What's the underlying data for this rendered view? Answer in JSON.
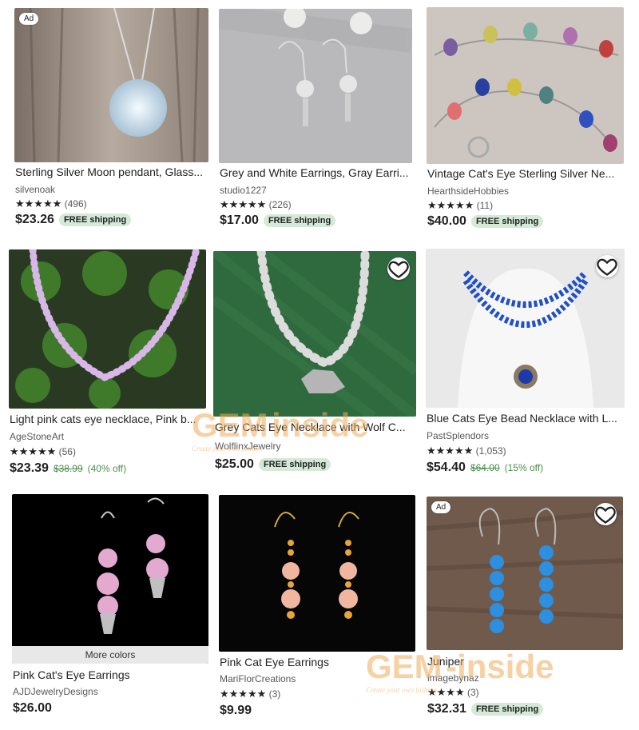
{
  "listings": [
    {
      "title": "Sterling Silver Moon pendant, Glass...",
      "shop": "silvenoak",
      "stars": "★★★★★",
      "reviews": "(496)",
      "price": "$23.26",
      "shipping": "FREE shipping",
      "badge": "Ad"
    },
    {
      "title": "Grey and White Earrings, Gray Earri...",
      "shop": "studio1227",
      "stars": "★★★★★",
      "reviews": "(226)",
      "price": "$17.00",
      "shipping": "FREE shipping"
    },
    {
      "title": "Vintage Cat's Eye Sterling Silver Ne...",
      "shop": "HearthsideHobbies",
      "stars": "★★★★★",
      "reviews": "(11)",
      "price": "$40.00",
      "shipping": "FREE shipping"
    },
    {
      "title": "Light pink cats eye necklace, Pink b...",
      "shop": "AgeStoneArt",
      "stars": "★★★★★",
      "reviews": "(56)",
      "price": "$23.39",
      "original_price": "$38.99",
      "discount": "(40% off)"
    },
    {
      "title": "Grey Cats Eye Necklace with Wolf C...",
      "shop": "WolflinxJewelry",
      "stars": "",
      "reviews": "",
      "price": "$25.00",
      "shipping": "FREE shipping"
    },
    {
      "title": "Blue Cats Eye Bead Necklace with L...",
      "shop": "PastSplendors",
      "stars": "★★★★★",
      "reviews": "(1,053)",
      "price": "$54.40",
      "original_price": "$64.00",
      "discount": "(15% off)"
    },
    {
      "title": "Pink Cat's Eye Earrings",
      "shop": "AJDJewelryDesigns",
      "stars": "",
      "reviews": "",
      "price": "$26.00",
      "more_colors": "More colors"
    },
    {
      "title": "Pink Cat Eye Earrings",
      "shop": "MariFlorCreations",
      "stars": "★★★★★",
      "reviews": "(3)",
      "price": "$9.99"
    },
    {
      "title": "Juniper",
      "shop": "imagebynaz",
      "stars": "★★★★",
      "reviews": "(3)",
      "price": "$32.31",
      "shipping": "FREE shipping",
      "badge": "Ad"
    }
  ],
  "watermark": {
    "brand": "GEM",
    "suffix": "inside",
    "tagline": "Create your own fashion",
    "brand2": "GEM",
    "suffix2": "-inside",
    "tagline2": "Create your own fashion"
  },
  "icons": {
    "favorite": "heart-outline-icon"
  },
  "colors": {
    "discount_green": "#4c8f4c",
    "shipping_bg": "#d4e9d7"
  }
}
